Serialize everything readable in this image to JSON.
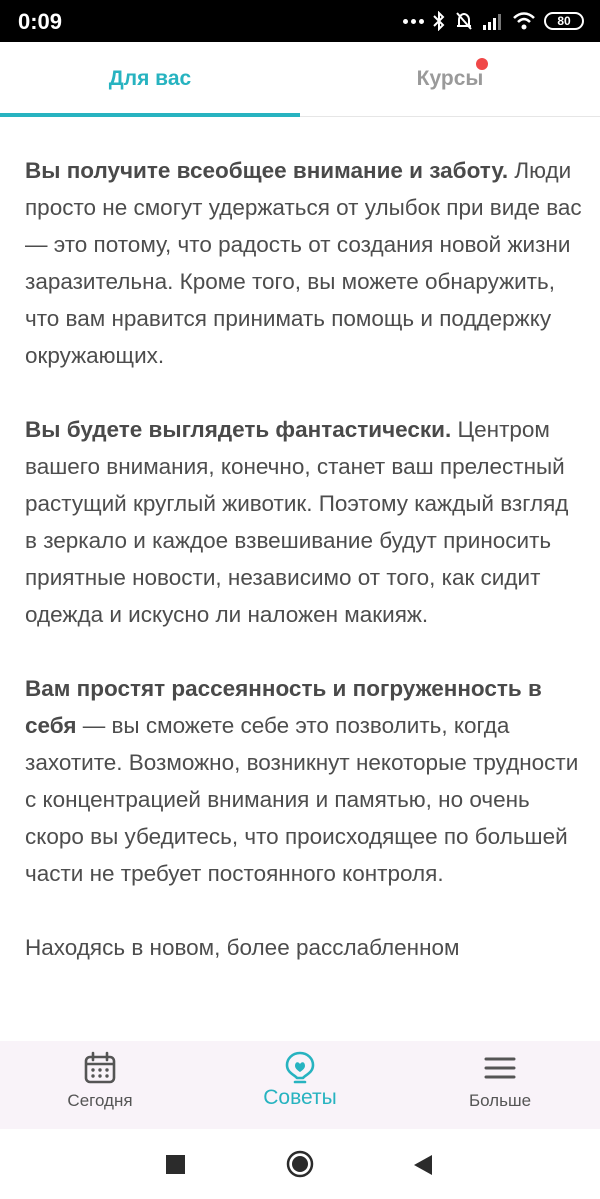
{
  "status_bar": {
    "time": "0:09",
    "battery": "80"
  },
  "tabs": {
    "for_you": "Для вас",
    "courses": "Курсы"
  },
  "article": {
    "p1": {
      "bold": "Вы получите всеобщее внимание и заботу.",
      "text": " Люди просто не смогут удержаться от улыбок при виде вас — это потому, что радость от создания новой жизни заразительна. Кроме того, вы можете обнаружить, что вам нравится принимать помощь и поддержку окружающих."
    },
    "p2": {
      "bold": "Вы будете выглядеть фантастически.",
      "text": " Центром вашего внимания, конечно, станет ваш прелестный растущий круглый животик. Поэтому каждый взгляд в зеркало и каждое взвешивание будут приносить приятные новости, независимо от того, как сидит одежда и искусно ли наложен макияж."
    },
    "p3": {
      "bold": "Вам простят рассеянность и погруженность в себя",
      "text": " — вы сможете себе это позволить, когда захотите. Возможно, возникнут некоторые трудности с концентрацией внимания и памятью, но очень скоро вы убедитесь, что происходящее по большей части не требует постоянного контроля."
    },
    "p4": {
      "text": "Находясь в новом, более расслабленном"
    }
  },
  "bottom_nav": {
    "today": "Сегодня",
    "advice": "Советы",
    "more": "Больше"
  },
  "colors": {
    "accent": "#27b3c0",
    "inactive": "#9a9a9a",
    "notification": "#f04848",
    "nav_bg": "#f9f3f9"
  }
}
